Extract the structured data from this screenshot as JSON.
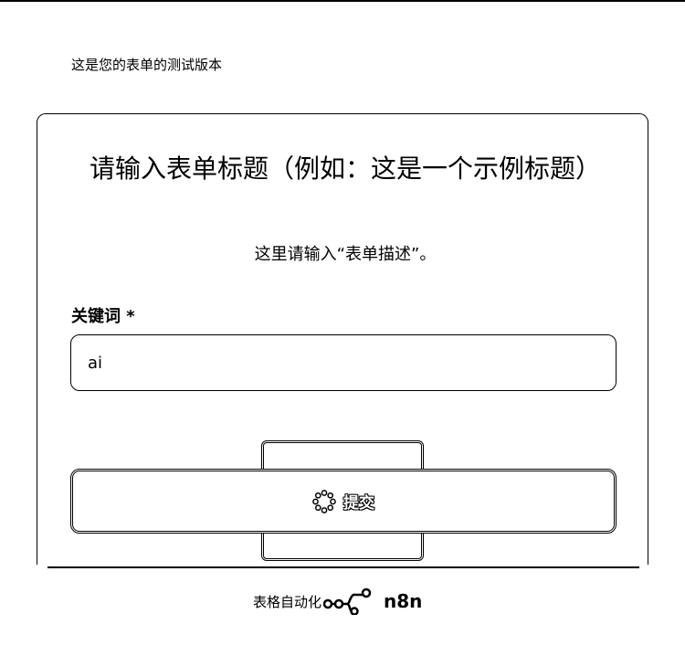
{
  "banner": {
    "text": "这是您的表单的测试版本"
  },
  "form": {
    "title": "请输入表单标题（例如：这是一个示例标题）",
    "description": "这里请输入“表单描述”。",
    "fields": [
      {
        "label": "关键词 *",
        "value": "ai"
      }
    ],
    "submit_label": "提交"
  },
  "footer": {
    "text": "表格自动化",
    "brand": "n8n"
  }
}
